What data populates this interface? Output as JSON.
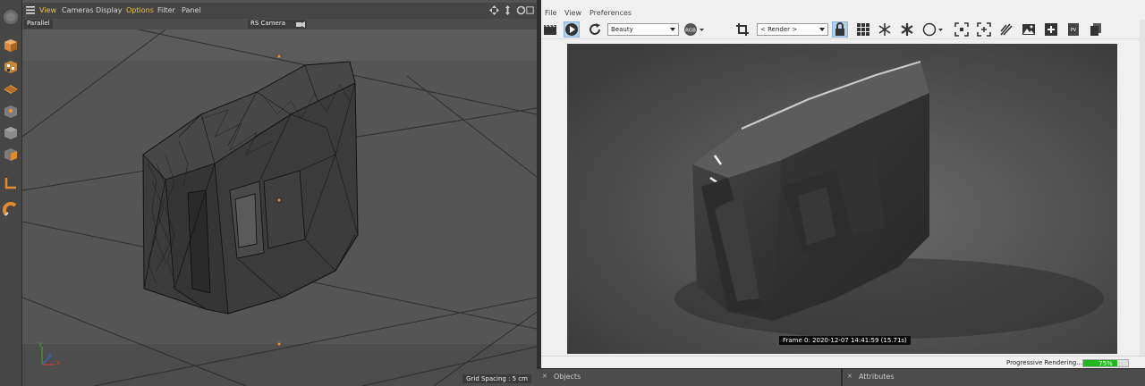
{
  "viewport": {
    "menu": [
      "View",
      "Cameras",
      "Display",
      "Options",
      "Filter",
      "Panel"
    ],
    "active_menu_color": "#e8c24a",
    "projection_label": "Parallel",
    "camera_label": "RS Camera",
    "grid_spacing": "Grid Spacing : 5 cm",
    "axis_labels": {
      "x": "x",
      "y": "y",
      "z": "z"
    },
    "nav_icons": [
      "move-view-icon",
      "scale-view-icon",
      "rotate-view-icon",
      "maximize-view-icon"
    ]
  },
  "tool_strip": {
    "icons": [
      "make-editable-icon",
      "model-mode-icon",
      "texture-mode-icon",
      "workplane-mode-icon",
      "points-mode-icon",
      "polygons-mode-icon",
      "edges-mode-icon",
      "axis-mode-icon",
      "snap-magnet-icon"
    ]
  },
  "render_view": {
    "menu": [
      "File",
      "View",
      "Preferences"
    ],
    "aov_select": "Beauty",
    "rgb_badge": "RGB",
    "render_select": "< Render >",
    "toolbar_icons": [
      "clapper-icon",
      "play-icon",
      "refresh-icon",
      "rgb-icon",
      "crop-icon",
      "render-select-icon",
      "lock-icon",
      "grid-icon",
      "snowflake-icon",
      "snowflake-filled-icon",
      "circle-icon",
      "focus-icon",
      "region-icon",
      "brush-icon",
      "image-icon",
      "add-snapshot-icon",
      "pv-icon",
      "copy-icon"
    ],
    "frame_info": "Frame 0: 2020-12-07 14:41:59 (15.71s)",
    "status": "Progressive Rendering...",
    "progress": 0.75,
    "progress_label": "75%",
    "progress_color": "#1fb81f"
  },
  "bottom_panels": {
    "objects_tab": "Objects",
    "attributes_tab": "Attributes"
  }
}
